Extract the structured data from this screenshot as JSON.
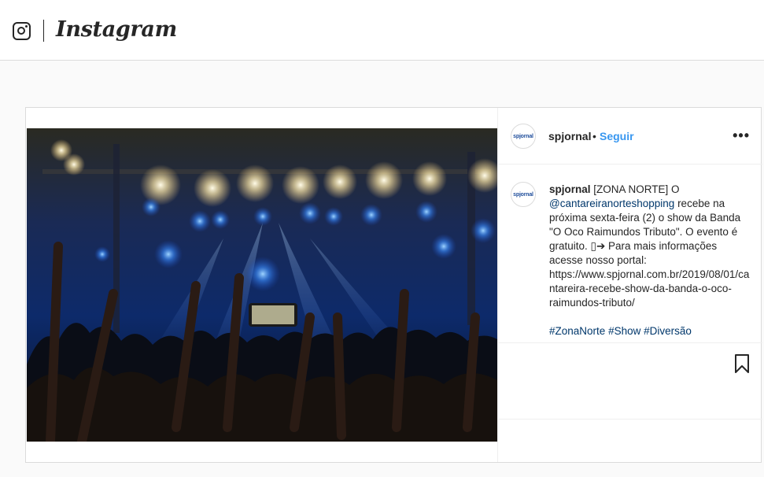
{
  "header": {
    "logo_icon": "instagram-glyph-icon",
    "wordmark": "Instagram"
  },
  "post": {
    "image_description_icon": "concert-photo",
    "author": {
      "username": "spjornal",
      "avatar_text": "spjornal",
      "separator": "•",
      "follow_label": "Seguir"
    },
    "more_icon": "more-options-icon",
    "more_glyph": "•••",
    "caption": {
      "username": "spjornal",
      "text_1": "[ZONA NORTE] O ",
      "mention": "@cantareiranorteshopping",
      "text_2": " recebe na próxima sexta-feira (2) o show da Banda \"O Oco Raimundos Tributo\". O evento é gratuito. ",
      "emoji": "▯➔",
      "text_3": " Para mais informações acesse nosso portal: https://www.spjornal.com.br/2019/08/01/cantareira-recebe-show-da-banda-o-oco-raimundos-tributo/",
      "hashtags": [
        "#ZonaNorte",
        "#Show",
        "#Diversão"
      ]
    },
    "bookmark_icon": "bookmark-icon"
  },
  "colors": {
    "link_blue": "#3897f0",
    "mention_blue": "#00376b",
    "border": "#dbdbdb",
    "background": "#fafafa"
  }
}
